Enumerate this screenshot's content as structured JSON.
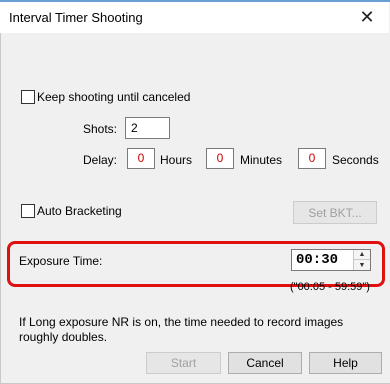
{
  "window": {
    "title": "Interval Timer Shooting",
    "close_icon": "close-icon"
  },
  "keep_shooting": {
    "label": "Keep shooting until canceled",
    "checked": false
  },
  "shots": {
    "label": "Shots:",
    "value": "2"
  },
  "delay": {
    "label": "Delay:",
    "hours_value": "0",
    "hours_label": "Hours",
    "minutes_value": "0",
    "minutes_label": "Minutes",
    "seconds_value": "0",
    "seconds_label": "Seconds",
    "value_color": "#d40000"
  },
  "auto_bracketing": {
    "label": "Auto Bracketing",
    "checked": false,
    "set_bkt_label": "Set BKT..."
  },
  "exposure": {
    "label": "Exposure Time:",
    "value": "00:30",
    "range": "(\"00:05 - 59:59\")",
    "highlight_color": "#e01010"
  },
  "note": "If Long exposure NR is on, the time needed to record images roughly doubles.",
  "buttons": {
    "start": "Start",
    "cancel": "Cancel",
    "help": "Help"
  }
}
